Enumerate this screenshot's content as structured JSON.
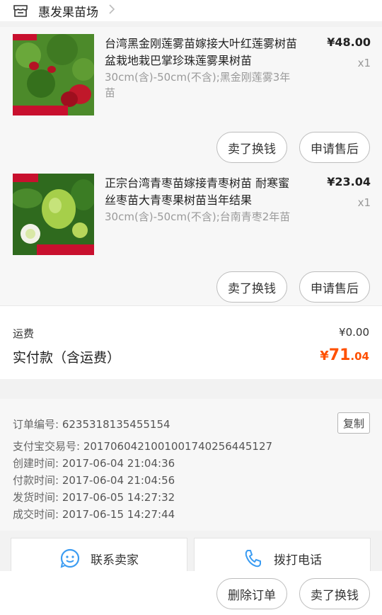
{
  "shop": {
    "name": "惠发果苗场",
    "icon": "store-icon"
  },
  "items": [
    {
      "title": "台湾黑金刚莲雾苗嫁接大叶红莲雾树苗盆栽地栽巴掌珍珠莲雾果树苗",
      "sku": "30cm(含)-50cm(不含);黑金刚莲雾3年苗",
      "price": "¥48.00",
      "qty": "x1",
      "thumb_banner": "莲雾苗-品种齐全",
      "thumb_logo": "惠发果苗",
      "btn_sell": "卖了换钱",
      "btn_after": "申请售后"
    },
    {
      "title": "正宗台湾青枣苗嫁接青枣树苗 耐寒蜜丝枣苗大青枣果树苗当年结果",
      "sku": "30cm(含)-50cm(不含);台南青枣2年苗",
      "price": "¥23.04",
      "qty": "x1",
      "thumb_banner": "台湾大青枣树苗",
      "thumb_logo": "惠发果苗",
      "btn_sell": "卖了换钱",
      "btn_after": "申请售后"
    }
  ],
  "totals": {
    "shipping_label": "运费",
    "shipping_value": "¥0.00",
    "paid_label": "实付款（含运费）",
    "paid_currency": "¥",
    "paid_integer": "71",
    "paid_decimal": ".04"
  },
  "order_info": {
    "order_no_label": "订单编号:",
    "order_no": "6235318135455154",
    "copy_label": "复制",
    "alipay_label": "支付宝交易号:",
    "alipay_no": "2017060421001001740256445127",
    "created_label": "创建时间:",
    "created": "2017-06-04 21:04:36",
    "paid_label": "付款时间:",
    "paid": "2017-06-04 21:04:56",
    "shipped_label": "发货时间:",
    "shipped": "2017-06-05 14:27:32",
    "completed_label": "成交时间:",
    "completed": "2017-06-15 14:27:44"
  },
  "contact": {
    "seller_label": "联系卖家",
    "seller_icon": "chat-smile-icon",
    "call_label": "拨打电话",
    "call_icon": "phone-icon"
  },
  "bottom": {
    "delete_label": "删除订单",
    "sell_label": "卖了换钱"
  },
  "colors": {
    "accent": "#ff5000",
    "icon_blue": "#3b9cf2"
  }
}
